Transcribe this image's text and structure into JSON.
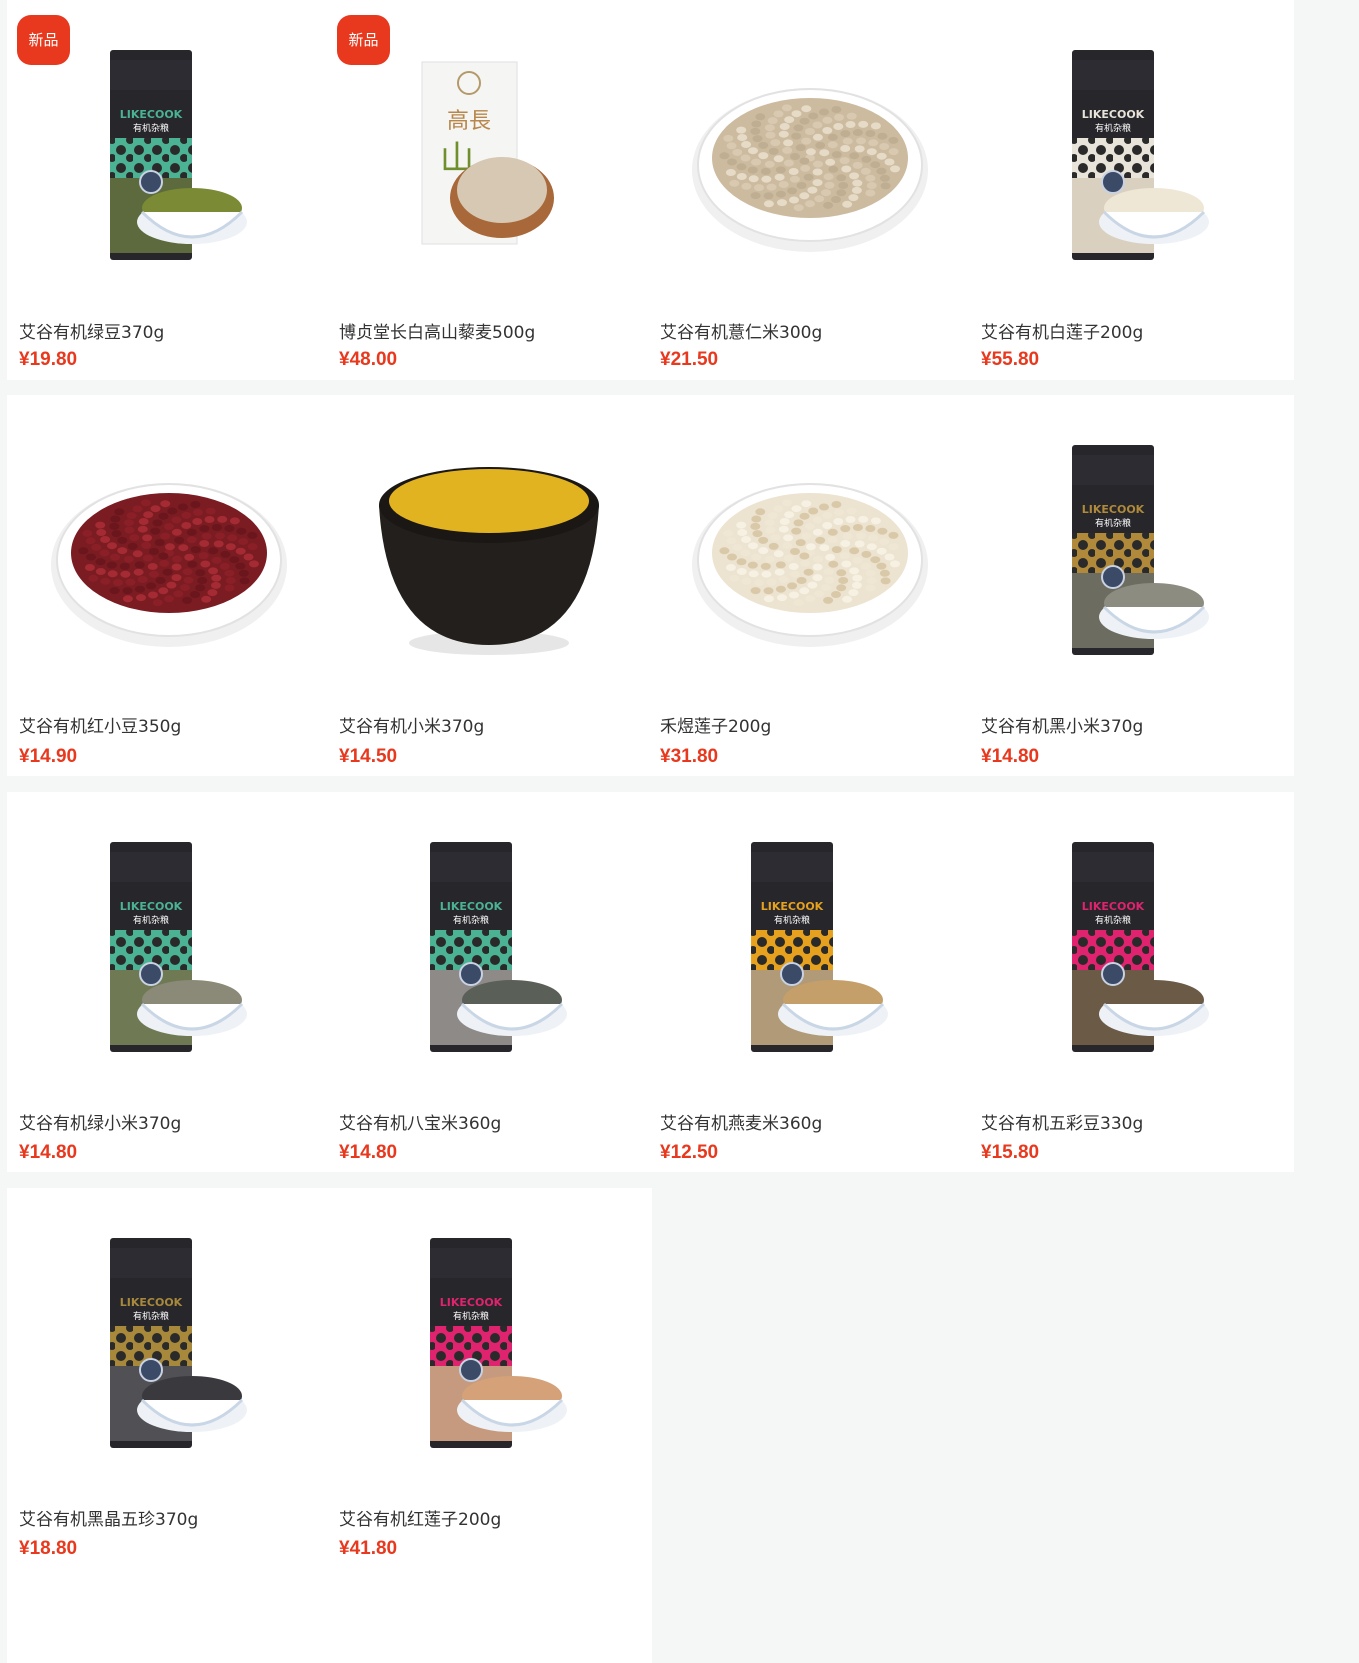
{
  "badge_label": "新品",
  "colors": {
    "price": "#e8381d",
    "badge": "#e8381d",
    "background": "#f5f6f6",
    "card": "#ffffff"
  },
  "products": [
    {
      "name": "艾谷有机绿豆370g",
      "price": "¥19.80",
      "badge": true,
      "image": "bag-teal-mungbean"
    },
    {
      "name": "博贞堂长白高山藜麦500g",
      "price": "¥48.00",
      "badge": true,
      "image": "box-quinoa"
    },
    {
      "name": "艾谷有机薏仁米300g",
      "price": "¥21.50",
      "badge": false,
      "image": "plate-barley"
    },
    {
      "name": "艾谷有机白莲子200g",
      "price": "¥55.80",
      "badge": false,
      "image": "bag-white-lotus"
    },
    {
      "name": "艾谷有机红小豆350g",
      "price": "¥14.90",
      "badge": false,
      "image": "plate-red-bean"
    },
    {
      "name": "艾谷有机小米370g",
      "price": "¥14.50",
      "badge": false,
      "image": "bowl-millet"
    },
    {
      "name": "禾煜莲子200g",
      "price": "¥31.80",
      "badge": false,
      "image": "plate-lotus"
    },
    {
      "name": "艾谷有机黑小米370g",
      "price": "¥14.80",
      "badge": false,
      "image": "bag-black-millet"
    },
    {
      "name": "艾谷有机绿小米370g",
      "price": "¥14.80",
      "badge": false,
      "image": "bag-green-millet"
    },
    {
      "name": "艾谷有机八宝米360g",
      "price": "¥14.80",
      "badge": false,
      "image": "bag-eight-treasure"
    },
    {
      "name": "艾谷有机燕麦米360g",
      "price": "¥12.50",
      "badge": false,
      "image": "bag-oat"
    },
    {
      "name": "艾谷有机五彩豆330g",
      "price": "¥15.80",
      "badge": false,
      "image": "bag-five-bean"
    },
    {
      "name": "艾谷有机黑晶五珍370g",
      "price": "¥18.80",
      "badge": false,
      "image": "bag-black-crystal"
    },
    {
      "name": "艾谷有机红莲子200g",
      "price": "¥41.80",
      "badge": false,
      "image": "bag-red-lotus"
    }
  ]
}
